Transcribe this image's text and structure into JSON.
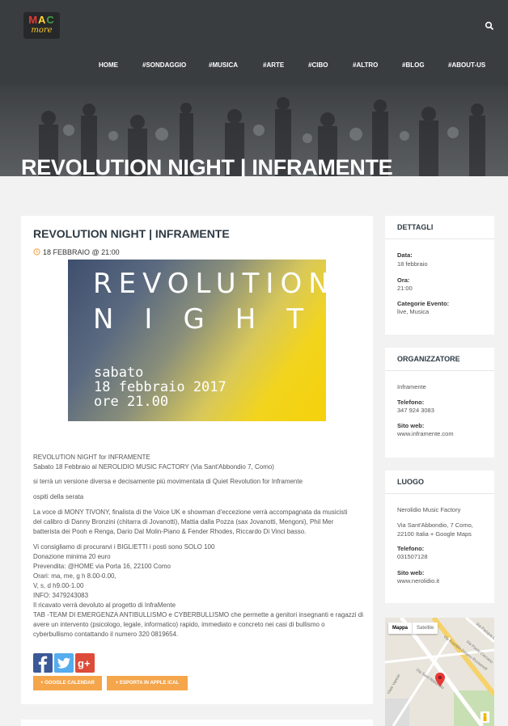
{
  "header": {
    "logo_text_top": "MAC",
    "logo_text_bottom": "more",
    "search_icon": "search-icon",
    "nav": [
      "HOME",
      "#SONDAGGIO",
      "#MUSICA",
      "#ARTE",
      "#CIBO",
      "#ALTRO",
      "#BLOG",
      "#ABOUT-US"
    ]
  },
  "hero": {
    "title": "REVOLUTION NIGHT | INFRAMENTE"
  },
  "event": {
    "title": "REVOLUTION NIGHT | INFRAMENTE",
    "date": "18 FEBBRAIO @ 21:00",
    "poster": {
      "line1": "REVOLUTION",
      "line2": "NIGHT",
      "line3": "sabato",
      "line4": "18 febbraio 2017",
      "line5": "ore 21.00"
    },
    "paragraphs": [
      "REVOLUTION NIGHT for INFRAMENTE",
      "Sabato 18 Febbraio al NEROLIDIO MUSIC FACTORY (Via Sant'Abbondio 7, Como)",
      "si terrà un versione diversa e decisamente più movimentata di Quiet Revolution for Inframente",
      "ospiti della serata",
      "La voce di MONY TIVONY, finalista di the Voice UK e showman d'eccezione verrà accompagnata da musicisti",
      "del calibro di Danny Bronzini (chitarra di Jovanotti), Mattia dalla Pozza (sax Jovanotti, Mengoni), Phil Mer",
      "batterista dei Pooh e Renga, Dario Dal Molin-Piano & Fender Rhodes, Riccardo Di Vinci basso.",
      "Vi consigliamo di procurarvi i BIGLIETTI i posti sono SOLO 100",
      "Donazione minima 20 euro",
      "Prevendita: @HOME via Porta 16, 22100 Como",
      "Orari: ma, me, g h 8.00-0.00,",
      "V, s, d h9.00-1.00",
      "INFO: 3479243083",
      "Il ricavato verrà devoluto al progetto di InfraMente",
      "TAB -TEAM DI EMERGENZA ANTIBULLISMO e CYBERBULLISMO che permette a genitori insegnanti e ragazzi di",
      "avere un intervento (psicologo, legale, informatico) rapido, immediato e concreto nei casi di bullismo o",
      "cyberbullismo contattando il numero 320 0819654."
    ],
    "buttons": {
      "google": "+ GOOGLE CALENDAR",
      "ical": "+ ESPORTA IN APPLE ICAL"
    }
  },
  "sidebar": {
    "dettagli": {
      "heading": "DETTAGLI",
      "data_label": "Data:",
      "data_value": "18 febbraio",
      "ora_label": "Ora:",
      "ora_value": "21:00",
      "cat_label": "Categorie Evento:",
      "cat_value": "live, Musica"
    },
    "organizzatore": {
      "heading": "ORGANIZZATORE",
      "name": "Inframente",
      "tel_label": "Telefono:",
      "tel_value": "347 924 3083",
      "web_label": "Sito web:",
      "web_value": "www.inframente.com"
    },
    "luogo": {
      "heading": "LUOGO",
      "name": "Nerolidio Music Factory",
      "addr1": "Via Sant'Abbondio, 7 Como,",
      "addr2": "22100 Italia + Google Maps",
      "tel_label": "Telefono:",
      "tel_value": "031507128",
      "web_label": "Sito web:",
      "web_value": "www.nerolidio.it"
    },
    "map": {
      "tab_map": "Mappa",
      "tab_sat": "Satellite",
      "street1": "Via Franklin Delano Roosevelt",
      "street2": "Via Sant'Abbondio",
      "street3": "Viale Varese",
      "street4": "Via Paolo Carcano",
      "street5": "Via Pasqua Liberia"
    }
  },
  "colors": {
    "header_bg": "#3a3d40",
    "accent": "#f5a54a",
    "title": "#2e3a44"
  }
}
